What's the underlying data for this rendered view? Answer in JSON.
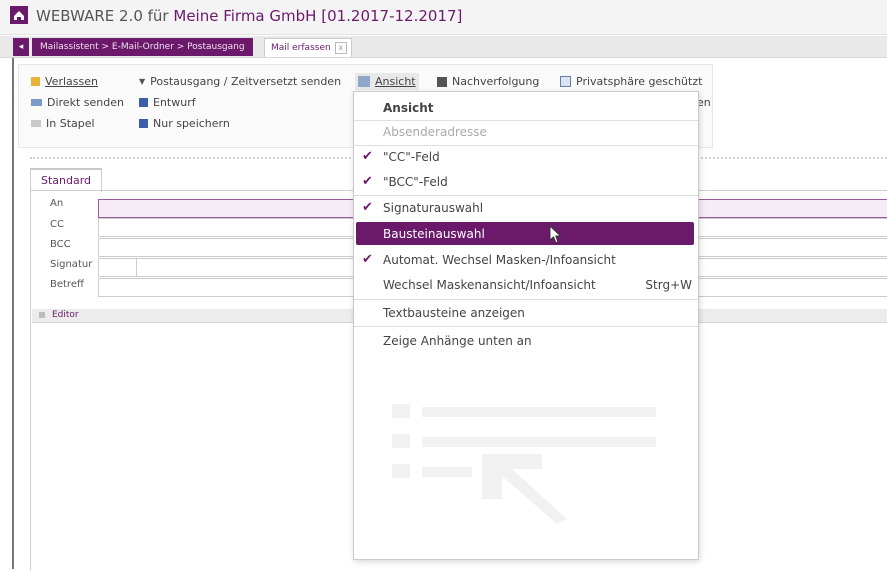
{
  "window": {
    "app_name": "WEBWARE 2.0 für",
    "company": "Meine Firma GmbH",
    "period": "[01.2017-12.2017]"
  },
  "tabs": {
    "back_glyph": "◂",
    "breadcrumb": "Mailassistent > E-Mail-Ordner > Postausgang",
    "active": "Mail erfassen",
    "close_glyph": "x"
  },
  "toolbar": {
    "verlassen": "Verlassen",
    "direkt_senden": "Direkt senden",
    "in_stapel": "In Stapel",
    "postausgang": "Postausgang / Zeitversetzt senden",
    "entwurf": "Entwurf",
    "nur_speichern": "Nur speichern",
    "ansicht": "Ansicht",
    "nachverfolgung": "Nachverfolgung",
    "privatsphaere": "Privatsphäre geschützt",
    "partial_label": "en"
  },
  "form": {
    "tab": "Standard",
    "labels": {
      "an": "An",
      "cc": "CC",
      "bcc": "BCC",
      "signatur": "Signatur",
      "betreff": "Betreff"
    },
    "editor_label": "Editor"
  },
  "menu": {
    "header": "Ansicht",
    "items": [
      {
        "label": "Absenderadresse",
        "checked": false,
        "disabled": true
      },
      {
        "label": "\"CC\"-Feld",
        "checked": true
      },
      {
        "label": "\"BCC\"-Feld",
        "checked": true
      },
      {
        "label": "Signaturauswahl",
        "checked": true
      },
      {
        "label": "Bausteinauswahl",
        "checked": false,
        "highlighted": true
      },
      {
        "label": "Automat. Wechsel Masken-/Infoansicht",
        "checked": true
      },
      {
        "label": "Wechsel Maskenansicht/Infoansicht",
        "shortcut": "Strg+W"
      },
      {
        "label": "Textbausteine anzeigen"
      },
      {
        "label": "Zeige Anhänge unten an"
      }
    ],
    "check_glyph": "✔"
  },
  "colors": {
    "brand": "#6b1a6b",
    "highlight": "#6b1a6b"
  }
}
